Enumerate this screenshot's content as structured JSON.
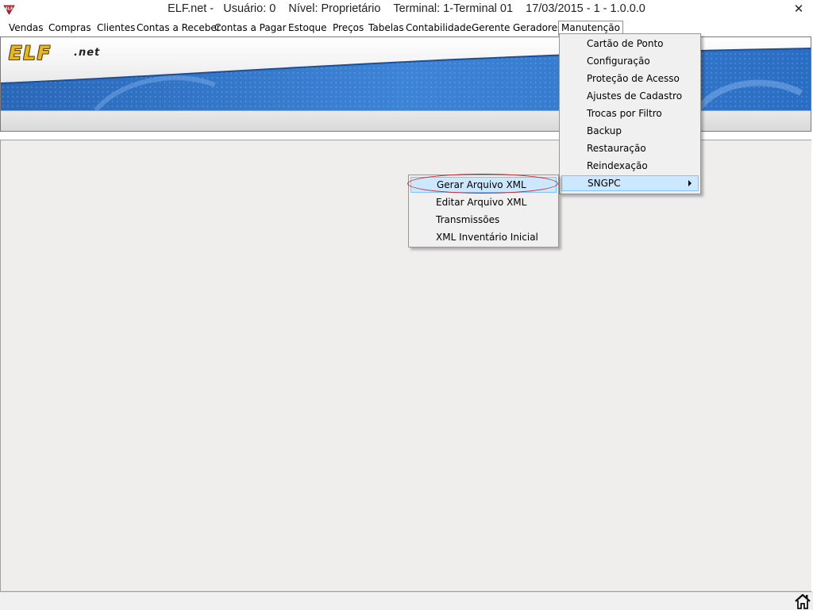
{
  "window": {
    "title": "ELF.net -   Usuário: 0    Nível: Proprietário    Terminal: 1-Terminal 01    17/03/2015 - 1 - 1.0.0.0",
    "app_icon": "elf-app-icon",
    "close_label": "✕"
  },
  "menubar": {
    "items": [
      {
        "label": "Vendas"
      },
      {
        "label": "Compras"
      },
      {
        "label": "Clientes"
      },
      {
        "label": "Contas a Receber"
      },
      {
        "label": "Contas a Pagar"
      },
      {
        "label": "Estoque"
      },
      {
        "label": "Preços"
      },
      {
        "label": "Tabelas"
      },
      {
        "label": "Contabilidade"
      },
      {
        "label": "Gerente"
      },
      {
        "label": "Geradores"
      },
      {
        "label": "Manutenção",
        "active": true
      }
    ]
  },
  "banner": {
    "logo": "ELF",
    "logo_suffix": ".net"
  },
  "manutencao_menu": {
    "items": [
      {
        "label": "Cartão de Ponto"
      },
      {
        "label": "Configuração"
      },
      {
        "label": "Proteção de Acesso"
      },
      {
        "label": "Ajustes de Cadastro"
      },
      {
        "label": "Trocas por Filtro"
      },
      {
        "label": "Backup"
      },
      {
        "label": "Restauração"
      },
      {
        "label": "Reindexação"
      },
      {
        "label": "SNGPC",
        "has_submenu": true,
        "highlighted": true
      }
    ]
  },
  "sngpc_submenu": {
    "items": [
      {
        "label": "Gerar Arquivo XML",
        "highlighted": true,
        "circled": true
      },
      {
        "label": "Editar Arquivo XML"
      },
      {
        "label": "Transmissões"
      },
      {
        "label": "XML Inventário Inicial"
      }
    ]
  },
  "statusbar": {
    "icon": "home-icon"
  },
  "colors": {
    "highlight": "#cce8ff",
    "highlight_border": "#7fc4ff",
    "annotation_ellipse": "#cc1f1f",
    "workspace": "#f0eded",
    "logo_gold": "#e8b620",
    "banner_blue": "#2e6fc0"
  }
}
